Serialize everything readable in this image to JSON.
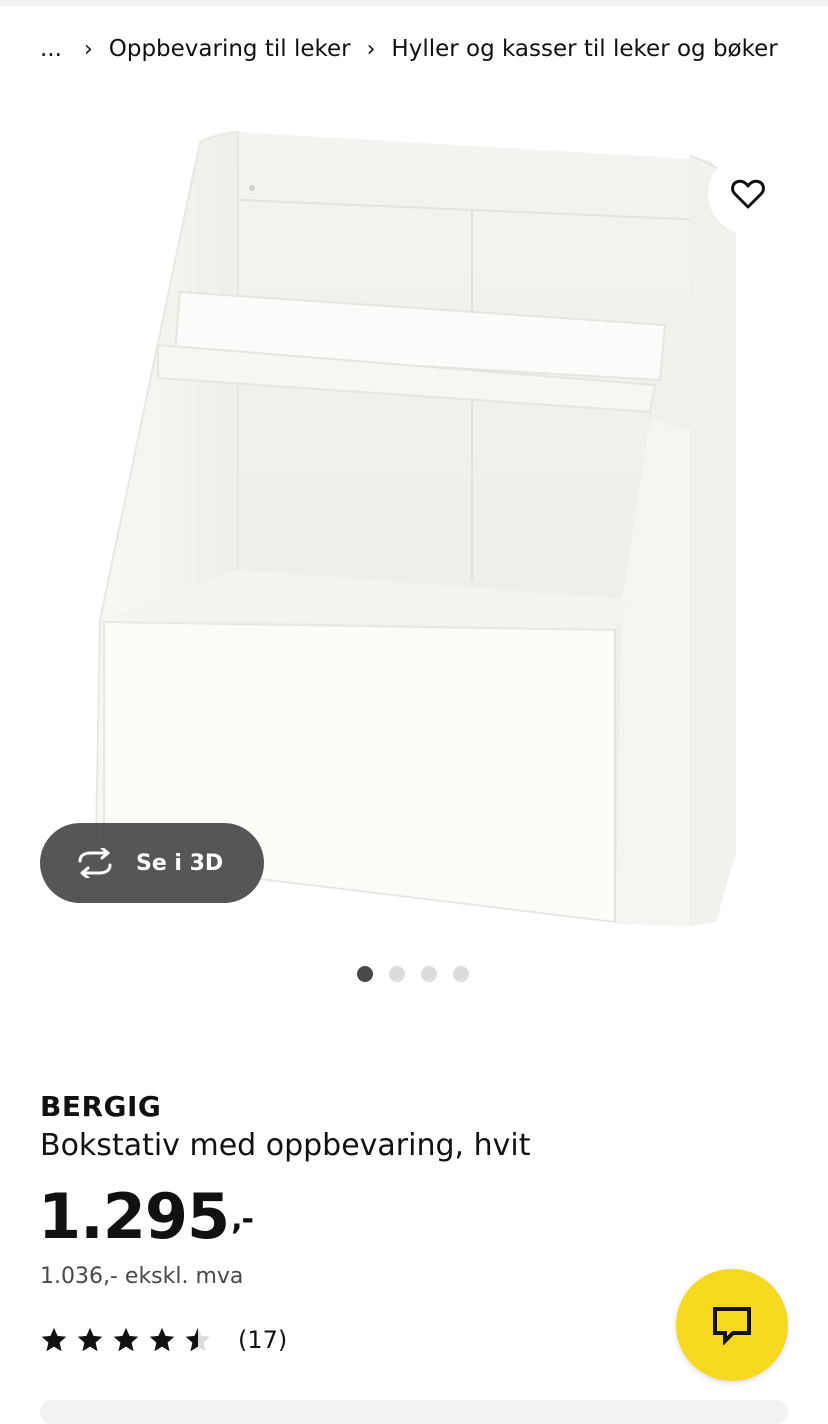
{
  "breadcrumb": {
    "ellipsis": "...",
    "separator": "›",
    "items": [
      "Oppbevaring til leker",
      "Hyller og kasser til leker og bøker"
    ]
  },
  "gallery": {
    "view_3d_label": "Se i 3D",
    "slide_count": 4,
    "active_slide": 1
  },
  "product": {
    "brand": "BERGIG",
    "description": "Bokstativ med oppbevaring, hvit",
    "price": "1.295",
    "price_suffix": ",-",
    "price_ex_vat": "1.036,- ekskl. mva",
    "rating": 4.5,
    "rating_max": 5,
    "review_count": "(17)"
  },
  "icons": {
    "favorite": "heart-icon",
    "rotate": "rotate-3d-icon",
    "chat": "chat-icon",
    "star": "star-icon"
  },
  "colors": {
    "chat_button": "#f6d81f",
    "btn_3d": "#484848",
    "dot_active": "#484848",
    "dot_inactive": "#dcdcdc"
  }
}
